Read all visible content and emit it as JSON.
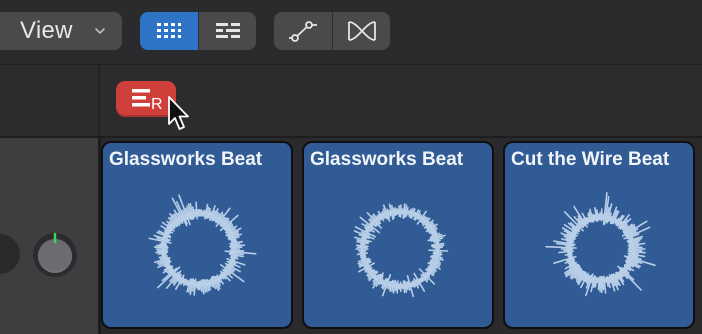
{
  "toolbar": {
    "view_menu_label": "View",
    "view_menu_icon": "chevron-down-icon",
    "view_mode_buttons": [
      {
        "name": "grid-view",
        "icon": "grid-icon",
        "active": true
      },
      {
        "name": "list-view",
        "icon": "list-icon",
        "active": false
      }
    ],
    "edit_mode_buttons": [
      {
        "name": "automation",
        "icon": "automation-curve-icon",
        "active": false
      },
      {
        "name": "transition",
        "icon": "crossfade-icon",
        "active": false
      }
    ],
    "active_color": "#2d74c6"
  },
  "track_header": {
    "record_badge_letter": "R",
    "record_badge_icon": "record-list-icon",
    "record_badge_color": "#d0403a"
  },
  "cells": [
    {
      "title": "Glassworks Beat",
      "color": "#305b94"
    },
    {
      "title": "Glassworks Beat",
      "color": "#305b94"
    },
    {
      "title": "Cut the Wire Beat",
      "color": "#305b94"
    }
  ]
}
